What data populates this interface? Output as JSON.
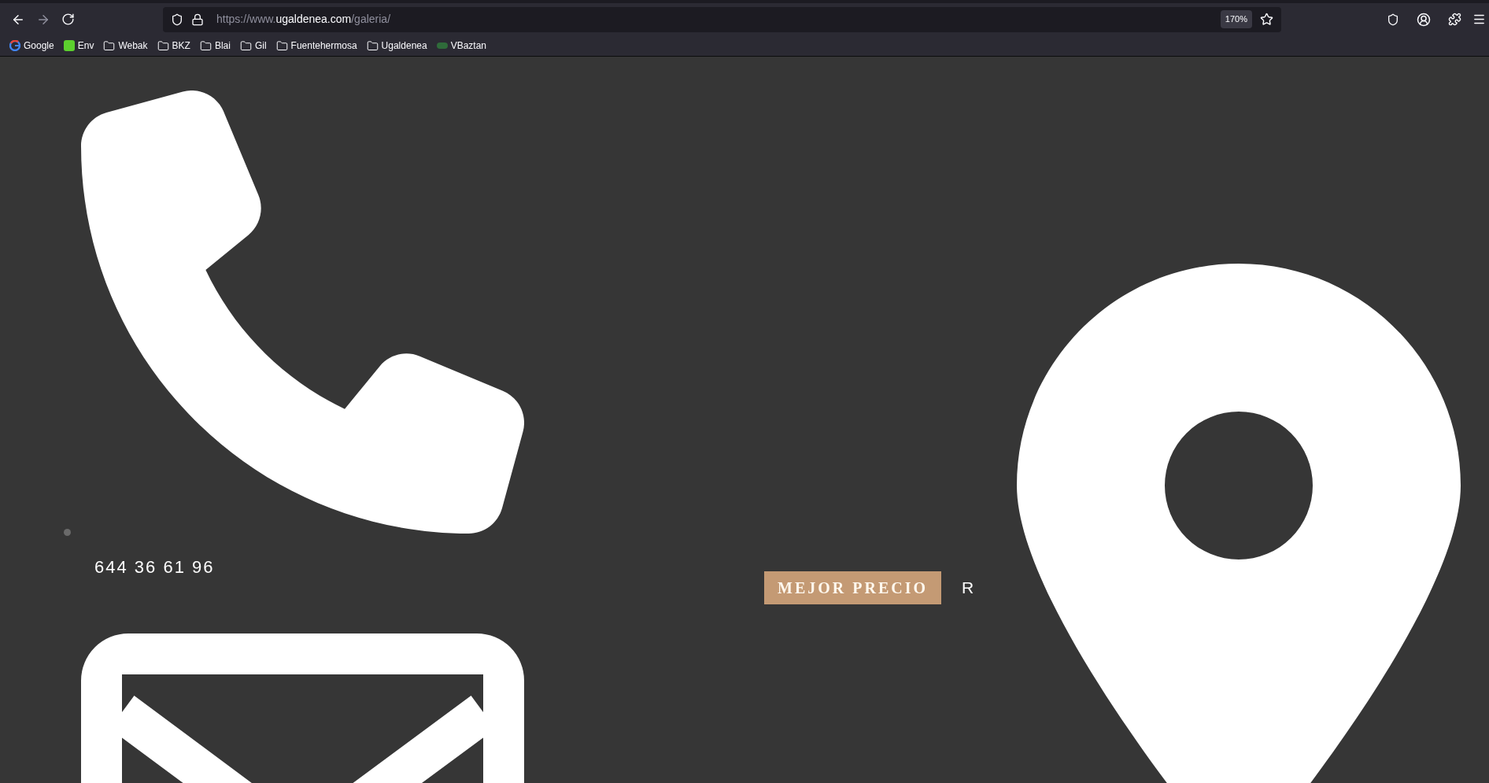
{
  "browser": {
    "address": {
      "prefix": "https://www.",
      "domain": "ugaldenea.com",
      "path": "/galeria/"
    },
    "zoom": "170%",
    "bookmarks": [
      {
        "kind": "google",
        "label": "Google"
      },
      {
        "kind": "app",
        "label": "Env"
      },
      {
        "kind": "folder",
        "label": "Webak"
      },
      {
        "kind": "folder",
        "label": "BKZ"
      },
      {
        "kind": "folder",
        "label": "Blai"
      },
      {
        "kind": "folder",
        "label": "Gil"
      },
      {
        "kind": "folder",
        "label": "Fuentehermosa"
      },
      {
        "kind": "folder",
        "label": "Ugaldenea"
      },
      {
        "kind": "site",
        "label": "VBaztan"
      }
    ]
  },
  "page": {
    "phone": "644 36 61 96",
    "badge": "MEJOR PRECIO",
    "after_badge": "R"
  }
}
